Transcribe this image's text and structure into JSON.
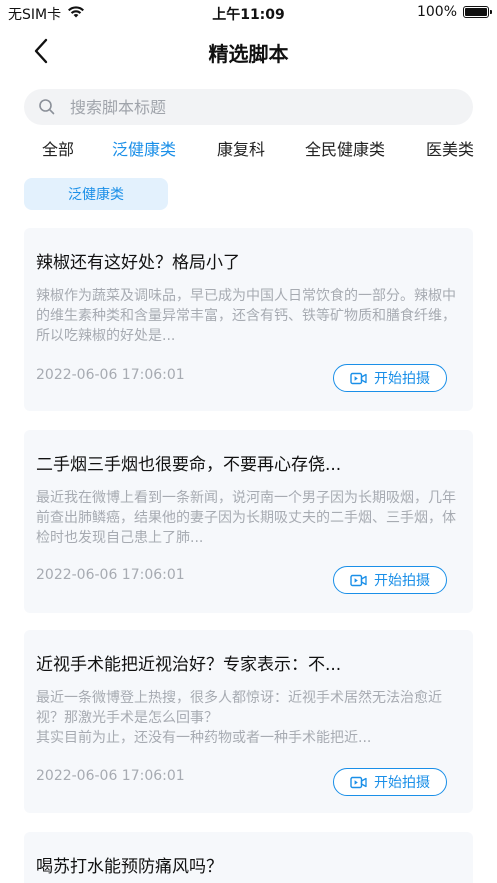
{
  "status_bar": {
    "carrier": "无SIM卡",
    "time": "上午11:09",
    "battery": "100%",
    "battery_level": 1.0
  },
  "nav": {
    "title": "精选脚本"
  },
  "search": {
    "placeholder": "搜索脚本标题",
    "value": ""
  },
  "tabs": [
    {
      "label": "全部",
      "active": false
    },
    {
      "label": "泛健康类",
      "active": true
    },
    {
      "label": "康复科",
      "active": false
    },
    {
      "label": "全民健康类",
      "active": false
    },
    {
      "label": "医美类",
      "active": false
    }
  ],
  "filter_chip": {
    "label": "泛健康类"
  },
  "colors": {
    "accent": "#1a8fe8",
    "card_bg": "#f6f8fb",
    "muted_text": "#a7abb2"
  },
  "cards": [
    {
      "title": "辣椒还有这好处？格局小了",
      "desc": "辣椒作为蔬菜及调味品，早已成为中国人日常饮食的一部分。辣椒中的维生素种类和含量异常丰富，还含有钙、铁等矿物质和膳食纤维，所以吃辣椒的好处是...",
      "date": "2022-06-06 17:06:01",
      "button": "开始拍摄"
    },
    {
      "title": "二手烟三手烟也很要命，不要再心存侥...",
      "desc": "最近我在微博上看到一条新闻，说河南一个男子因为长期吸烟，几年前查出肺鳞癌，结果他的妻子因为长期吸丈夫的二手烟、三手烟，体检时也发现自己患上了肺...",
      "date": "2022-06-06 17:06:01",
      "button": "开始拍摄"
    },
    {
      "title": "近视手术能把近视治好？专家表示：不...",
      "desc": "最近一条微博登上热搜，很多人都惊讶：近视手术居然无法治愈近视？那激光手术是怎么回事？\n其实目前为止，还没有一种药物或者一种手术能把近...",
      "date": "2022-06-06 17:06:01",
      "button": "开始拍摄"
    },
    {
      "title": "喝苏打水能预防痛风吗？",
      "desc": "",
      "date": "",
      "button": ""
    }
  ]
}
